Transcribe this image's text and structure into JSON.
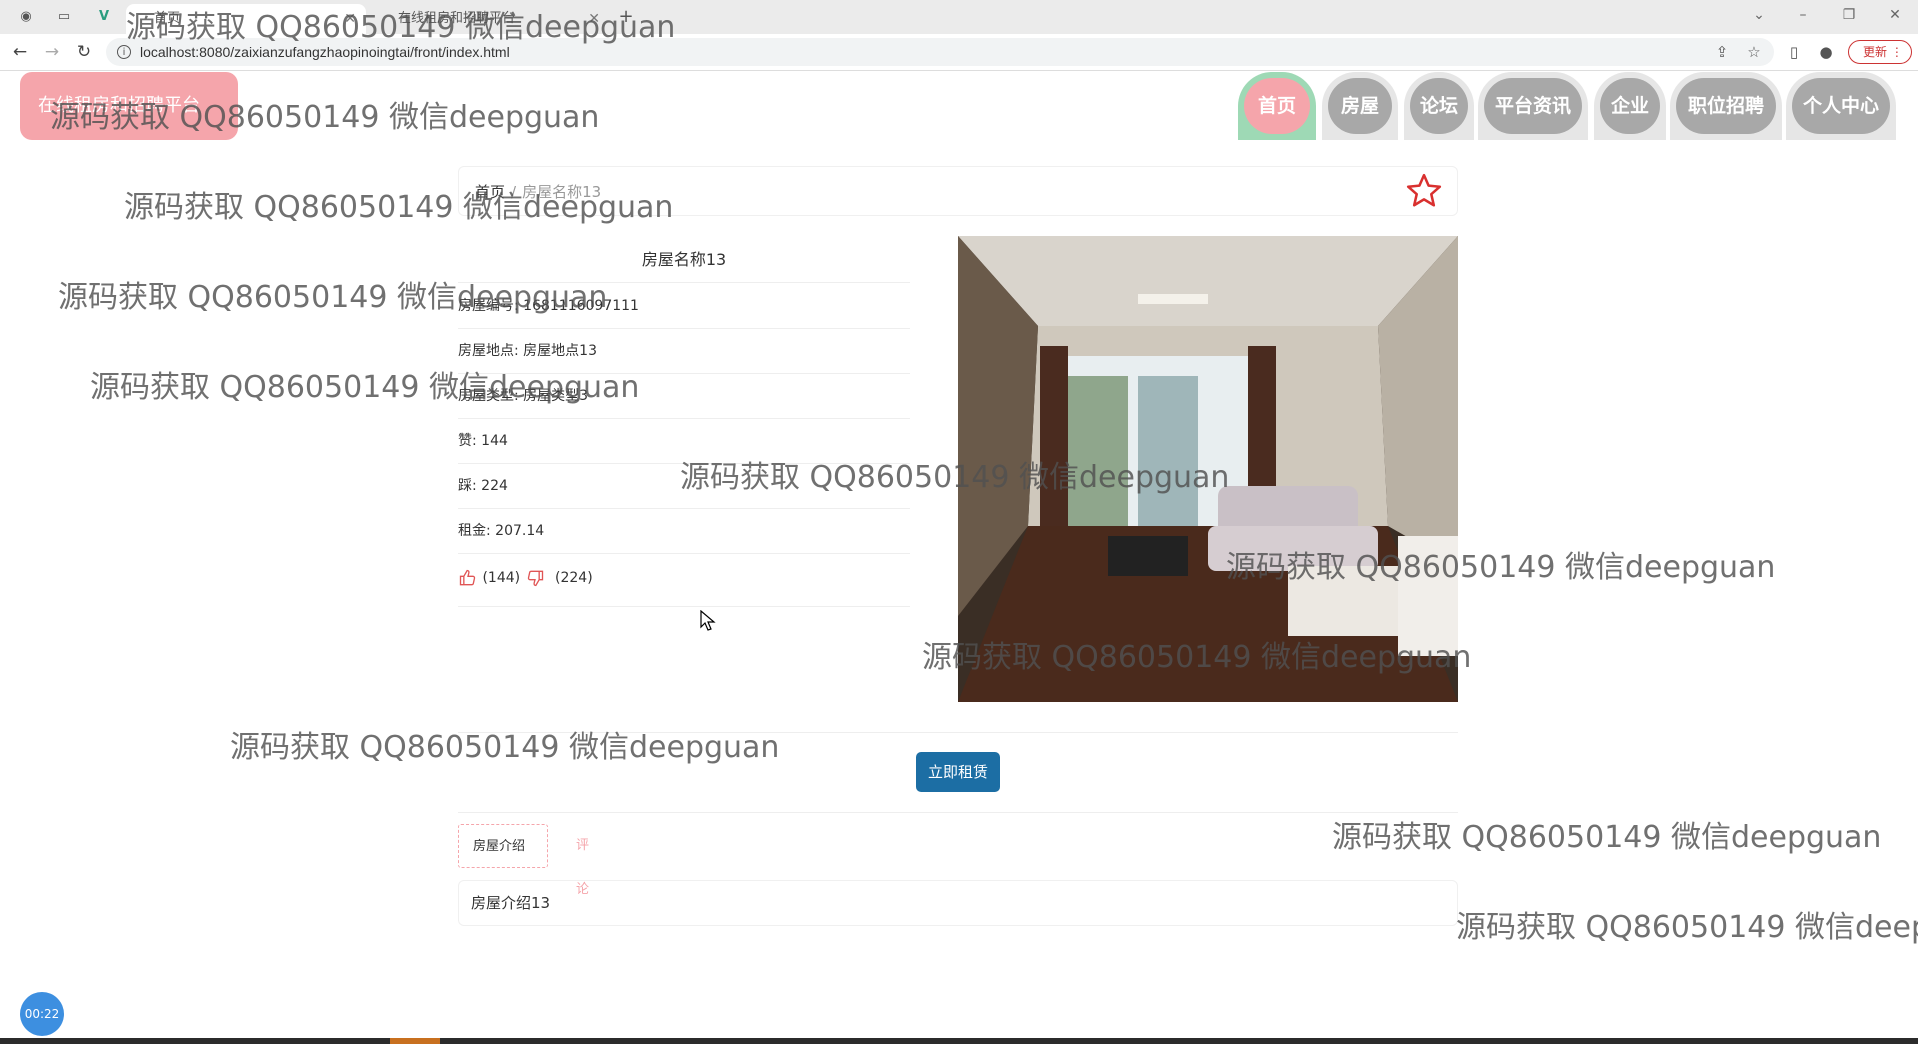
{
  "browser": {
    "tabs": [
      {
        "label": "首页"
      },
      {
        "label": "在线租房和招聘平台"
      }
    ],
    "url": "localhost:8080/zaixianzufangzhaopinoingtai/front/index.html",
    "update_label": "更新"
  },
  "header": {
    "logo": "在线租房和招聘平台",
    "nav": [
      "首页",
      "房屋",
      "论坛",
      "平台资讯",
      "企业",
      "职位招聘",
      "个人中心"
    ]
  },
  "breadcrumb": {
    "home": "首页",
    "separator": "/",
    "current": "房屋名称13"
  },
  "detail": {
    "title": "房屋名称13",
    "rows": [
      "房屋编号: 1681116097111",
      "房屋地点: 房屋地点13",
      "房屋类型: 房屋类型3",
      "赞: 144",
      "踩: 224",
      "租金: 207.14"
    ],
    "likes": "(144)",
    "dislikes": "(224)"
  },
  "actions": {
    "rent_label": "立即租赁"
  },
  "tabs": {
    "intro_label": "房屋介绍",
    "comment_label": "评论"
  },
  "intro_content": "房屋介绍13",
  "recorder": {
    "time": "00:22"
  },
  "watermark_text": "源码获取 QQ86050149 微信deepguan",
  "colors": {
    "accent_pink": "#f5a5ab",
    "accent_green": "#9ed9b5",
    "button_blue": "#1c6ea4",
    "star_red": "#d9302f"
  }
}
